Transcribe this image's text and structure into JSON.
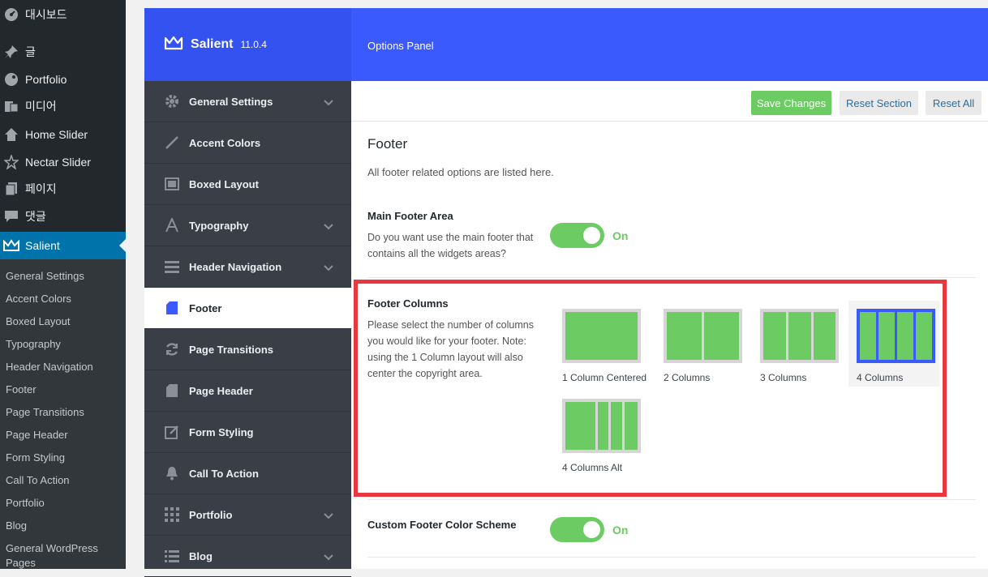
{
  "wp_menu": [
    {
      "label": "대시보드",
      "icon": "dashboard-icon"
    },
    {
      "label": "글",
      "icon": "pin-icon"
    },
    {
      "label": "Portfolio",
      "icon": "palette-icon"
    },
    {
      "label": "미디어",
      "icon": "media-icon"
    },
    {
      "label": "Home Slider",
      "icon": "home-icon"
    },
    {
      "label": "Nectar Slider",
      "icon": "star-icon"
    },
    {
      "label": "페이지",
      "icon": "pages-icon"
    },
    {
      "label": "댓글",
      "icon": "comment-icon"
    },
    {
      "label": "Salient",
      "icon": "crown-icon",
      "active": true
    }
  ],
  "wp_submenu": [
    "General Settings",
    "Accent Colors",
    "Boxed Layout",
    "Typography",
    "Header Navigation",
    "Footer",
    "Page Transitions",
    "Page Header",
    "Form Styling",
    "Call To Action",
    "Portfolio",
    "Blog",
    "General WordPress Pages"
  ],
  "header": {
    "brand": "Salient",
    "version": "11.0.4",
    "panel_title": "Options Panel"
  },
  "nav": [
    {
      "label": "General Settings",
      "icon": "gear-icon",
      "has_children": true
    },
    {
      "label": "Accent Colors",
      "icon": "brush-icon",
      "has_children": false
    },
    {
      "label": "Boxed Layout",
      "icon": "boxed-layout-icon",
      "has_children": false
    },
    {
      "label": "Typography",
      "icon": "font-icon",
      "has_children": true
    },
    {
      "label": "Header Navigation",
      "icon": "menu-bars-icon",
      "has_children": true
    },
    {
      "label": "Footer",
      "icon": "document-icon",
      "has_children": false,
      "active": true
    },
    {
      "label": "Page Transitions",
      "icon": "refresh-icon",
      "has_children": false
    },
    {
      "label": "Page Header",
      "icon": "page-icon",
      "has_children": false
    },
    {
      "label": "Form Styling",
      "icon": "edit-icon",
      "has_children": false
    },
    {
      "label": "Call To Action",
      "icon": "bell-icon",
      "has_children": false
    },
    {
      "label": "Portfolio",
      "icon": "grid-icon",
      "has_children": true
    },
    {
      "label": "Blog",
      "icon": "list-icon",
      "has_children": true
    }
  ],
  "toolbar": {
    "save_label": "Save Changes",
    "reset_section_label": "Reset Section",
    "reset_all_label": "Reset All"
  },
  "section": {
    "title": "Footer",
    "description": "All footer related options are listed here."
  },
  "main_footer_area": {
    "title": "Main Footer Area",
    "description": "Do you want use the main footer that contains all the widgets areas?",
    "value": "On"
  },
  "footer_columns": {
    "title": "Footer Columns",
    "description": "Please select the number of columns you would like for your footer. Note: using the 1 Column layout will also center the copyright area.",
    "options": [
      {
        "label": "1 Column Centered",
        "columns": 1
      },
      {
        "label": "2 Columns",
        "columns": 2
      },
      {
        "label": "3 Columns",
        "columns": 3
      },
      {
        "label": "4 Columns",
        "columns": 4,
        "selected": true
      },
      {
        "label": "4 Columns Alt",
        "columns": 4
      }
    ]
  },
  "custom_color_scheme": {
    "title": "Custom Footer Color Scheme",
    "value": "On"
  },
  "colors": {
    "accent_blue": "#3b5afe",
    "green": "#6dcb63",
    "highlight_red": "#e8373f"
  }
}
